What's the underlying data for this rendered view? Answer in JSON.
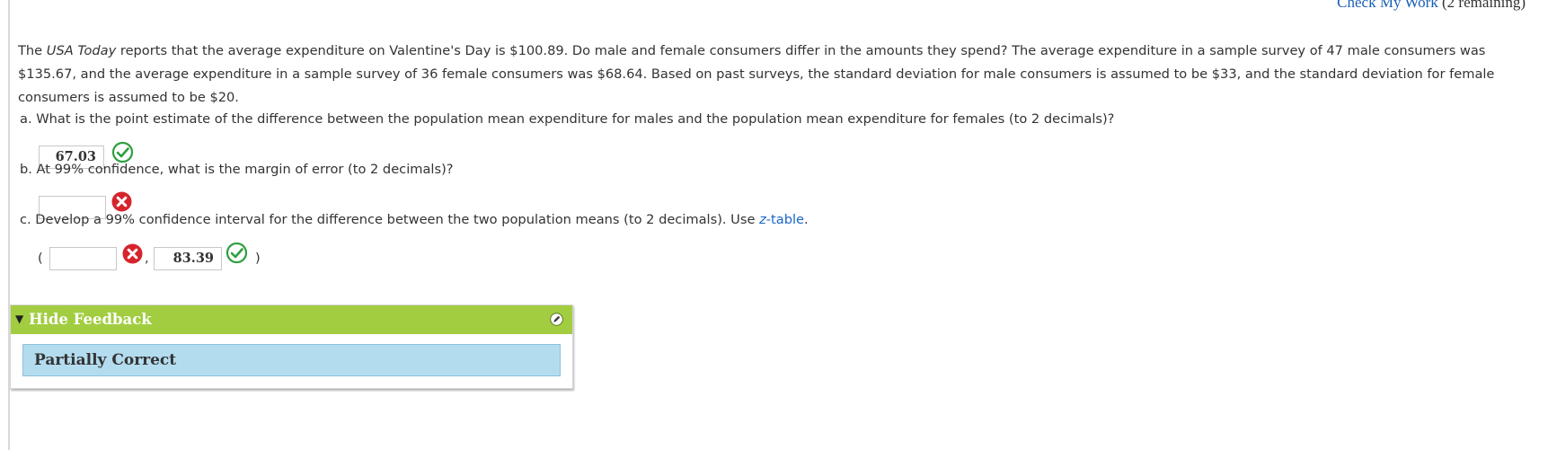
{
  "header": {
    "check_link": "Check My Work",
    "remaining": "(2 remaining)"
  },
  "question": {
    "intro_pre": "The ",
    "intro_source": "USA Today",
    "intro_post": " reports that the average expenditure on Valentine's Day is $100.89. Do male and female consumers differ in the amounts they spend? The average expenditure in a sample survey of 47 male consumers was $135.67, and the average expenditure in a sample survey of 36 female consumers was $68.64. Based on past surveys, the standard deviation for male consumers is assumed to be $33, and the standard deviation for female consumers is assumed to be $20."
  },
  "parts": {
    "a": {
      "prompt": "a. What is the point estimate of the difference between the population mean expenditure for males and the population mean expenditure for females (to 2 decimals)?",
      "answer": "67.03",
      "status": "correct"
    },
    "b": {
      "prompt": "b. At 99% confidence, what is the margin of error (to 2 decimals)?",
      "answer": "",
      "status": "incorrect"
    },
    "c": {
      "prompt_pre": "c. Develop a 99% confidence interval for the difference between the two population means (to 2 decimals). Use ",
      "link_italic": "z",
      "link_rest": "-table",
      "prompt_post": ".",
      "open_paren": "(",
      "comma": ",",
      "close_paren": ")",
      "lower": "",
      "lower_status": "incorrect",
      "upper": "83.39",
      "upper_status": "correct"
    }
  },
  "feedback": {
    "toggle_label": "Hide Feedback",
    "result": "Partially Correct"
  },
  "colors": {
    "link": "#1a66c6",
    "feedback_header": "#a2cd41",
    "feedback_body": "#b3dcef",
    "correct": "#2f9e3f",
    "incorrect": "#d6242c"
  },
  "icons": {
    "correct": "check-circle-icon",
    "incorrect": "x-circle-icon",
    "collapse": "triangle-down-icon",
    "edit": "pencil-icon"
  }
}
